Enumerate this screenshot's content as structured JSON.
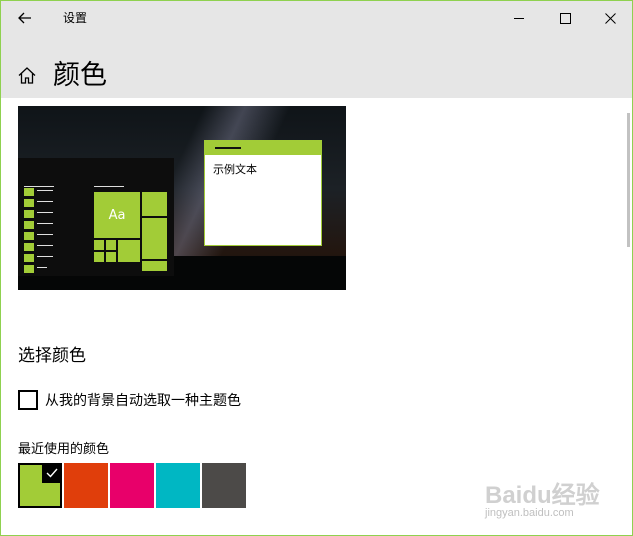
{
  "window": {
    "title": "设置",
    "controls": [
      "minimize",
      "maximize",
      "close"
    ]
  },
  "header": {
    "title": "颜色"
  },
  "preview": {
    "sample_text": "示例文本",
    "tile_label": "Aa",
    "accent_color": "#a2cc37"
  },
  "section": {
    "title": "选择颜色",
    "auto_pick": {
      "label": "从我的背景自动选取一种主题色",
      "checked": false
    },
    "recent_colors_label": "最近使用的颜色",
    "recent_colors": [
      {
        "color": "#a2cc37",
        "selected": true
      },
      {
        "color": "#e03e0b",
        "selected": false
      },
      {
        "color": "#e8006a",
        "selected": false
      },
      {
        "color": "#00b7c3",
        "selected": false
      },
      {
        "color": "#4c4a48",
        "selected": false
      }
    ]
  },
  "watermark": {
    "logo_text": "Baidu经验",
    "sub_text": "jingyan.baidu.com"
  },
  "icons": {
    "back": "back-arrow-icon",
    "home": "home-icon",
    "minimize": "minimize-icon",
    "maximize": "maximize-icon",
    "close": "close-icon",
    "check": "checkmark-icon"
  }
}
